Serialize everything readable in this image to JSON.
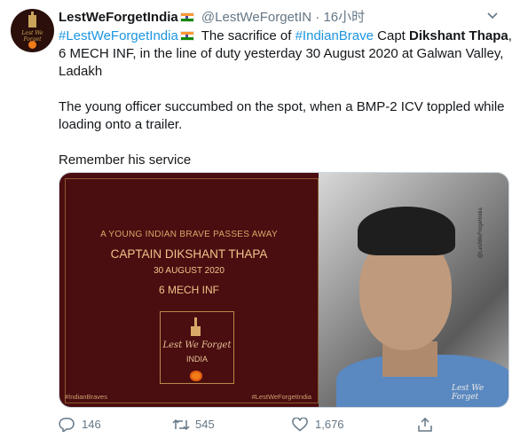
{
  "tweet": {
    "author_name": "LestWeForgetIndia",
    "handle": "@LestWeForgetIN",
    "separator": "·",
    "time": "16小时",
    "body": {
      "line1_hashtag1": "#LestWeForgetIndia",
      "line1_text1": " The sacrifice of ",
      "line1_hashtag2": "#IndianBrave",
      "line1_text2": " Capt ",
      "line1_bold": "Dikshant Thapa",
      "line1_text3": ", 6 MECH INF, in the line of duty yesterday 30 August 2020 at Galwan Valley, Ladakh",
      "paragraph2": "The young officer succumbed on the spot, when a BMP-2 ICV toppled while loading onto a trailer.",
      "paragraph3": "Remember his service"
    },
    "media": {
      "heading": "A YOUNG INDIAN BRAVE PASSES AWAY",
      "name": "CAPTAIN DIKSHANT THAPA",
      "date": "30 AUGUST 2020",
      "unit": "6 MECH INF",
      "logo_motto": "Lest We Forget",
      "logo_brand": "INDIA",
      "hashtag_left": "#IndianBraves",
      "hashtag_right": "#LestWeForgetIndia",
      "photo_watermark": "Lest We Forget",
      "photo_side_text": "@LestWeForgetIndia"
    },
    "actions": {
      "reply_count": "146",
      "retweet_count": "545",
      "like_count": "1,676"
    }
  },
  "colors": {
    "link": "#1b95e0",
    "muted": "#657786",
    "poster_bg": "#4a0d10",
    "poster_text": "#f2c48a"
  },
  "icons": {
    "menu": "chevron-down-icon",
    "reply": "reply-icon",
    "retweet": "retweet-icon",
    "like": "heart-icon",
    "share": "share-icon",
    "flag": "india-flag-icon"
  }
}
